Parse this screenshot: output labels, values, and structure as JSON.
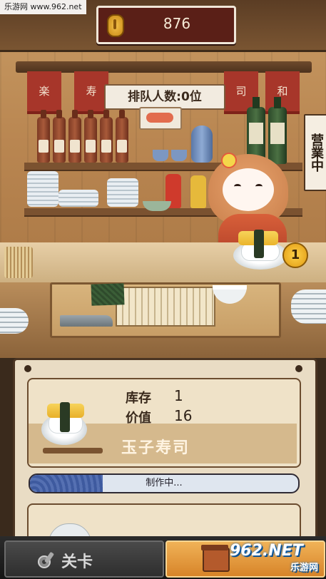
{
  "watermark": "乐游网 www.962.net",
  "currency": {
    "coins": "876",
    "icon": "coin-icon"
  },
  "queue": {
    "label": "排队人数:0位"
  },
  "business_sign": "营業中",
  "noren_chars": [
    "楽",
    "寿",
    "司",
    "和"
  ],
  "order": {
    "count": "1"
  },
  "item": {
    "stock_label": "库存",
    "stock_value": "1",
    "value_label": "价值",
    "value_value": "16",
    "name": "玉子寿司"
  },
  "progress": {
    "text": "制作中...",
    "fraction": 0.27
  },
  "nav": {
    "level_label": "关卡",
    "level_icon": "wrench-gear-icon",
    "shop_icon": "shop-icon"
  },
  "corner_logo": {
    "brand": "962.NET",
    "sub": "乐游网"
  }
}
